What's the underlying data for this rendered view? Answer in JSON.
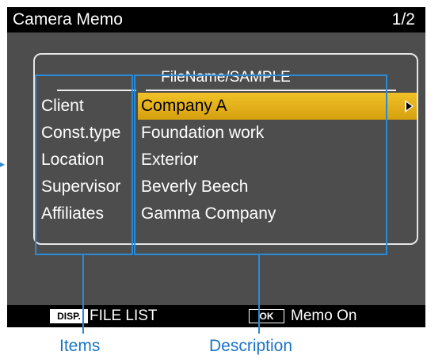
{
  "header": {
    "title": "Camera Memo",
    "page": "1/2"
  },
  "panel": {
    "filename": "FileName/SAMPLE"
  },
  "items": [
    "Client",
    "Const.type",
    "Location",
    "Supervisor",
    "Affiliates"
  ],
  "descriptions": [
    "Company A",
    "Foundation work",
    "Exterior",
    "Beverly Beech",
    "Gamma Company"
  ],
  "selected_index": 0,
  "footer": {
    "disp_key": "DISP.",
    "disp_label": "FILE LIST",
    "ok_key": "OK",
    "ok_label": "Memo On"
  },
  "captions": {
    "items": "Items",
    "description": "Description"
  },
  "colors": {
    "highlight": "#e0ac12",
    "callout": "#2b8ad6",
    "caption": "#1a73c9"
  }
}
